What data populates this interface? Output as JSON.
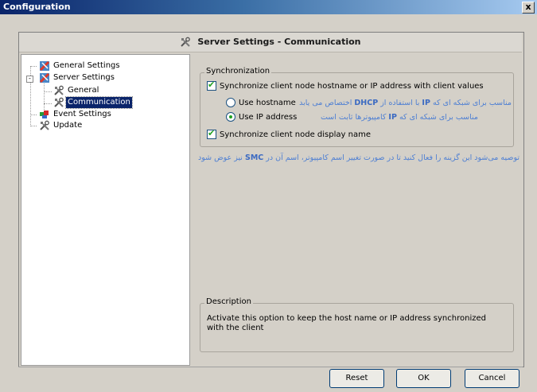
{
  "window": {
    "title": "Configuration",
    "close_label": "x"
  },
  "header": {
    "title": "Server Settings - Communication"
  },
  "tree": {
    "items": [
      {
        "label": "General Settings",
        "icon": "general-settings-icon"
      },
      {
        "label": "Server Settings",
        "icon": "server-settings-icon",
        "expander": "-"
      },
      {
        "label": "General",
        "icon": "tools-icon"
      },
      {
        "label": "Communication",
        "icon": "tools-icon",
        "selected": true
      },
      {
        "label": "Event Settings",
        "icon": "event-settings-icon"
      },
      {
        "label": "Update",
        "icon": "tools-icon"
      }
    ]
  },
  "sync": {
    "group_title": "Synchronization",
    "sync_hostname_label": "Synchronize client node hostname or IP address with client values",
    "sync_hostname_checked": true,
    "use_hostname_label": "Use hostname",
    "use_hostname_note_prefix": "مناسب برای شبکه ای که",
    "use_hostname_note_ip": "IP",
    "use_hostname_note_mid": "با استفاده از",
    "use_hostname_note_dhcp": "DHCP",
    "use_hostname_note_suffix": "اختصاص می یابد",
    "use_ip_label": "Use IP address",
    "use_ip_selected": true,
    "use_ip_note_prefix": "مناسب برای شبکه ای که",
    "use_ip_note_ip": "IP",
    "use_ip_note_suffix": "کامپیوترها ثابت است",
    "sync_display_label": "Synchronize client node display name",
    "sync_display_checked": true
  },
  "recommend_note": {
    "prefix": "توصیه می‌شود این گزینه را فعال کنید تا در صورت تغییر اسم کامپیوتر، اسم آن در",
    "smc": "SMC",
    "suffix": "نیز عوض شود"
  },
  "description": {
    "group_title": "Description",
    "text": "Activate this option to keep the host name or IP address synchronized with the client"
  },
  "buttons": {
    "reset": "Reset",
    "ok": "OK",
    "cancel": "Cancel"
  },
  "colors": {
    "title_bar": "#0a246a",
    "selection": "#0a246a",
    "note_text": "#4e7fd3",
    "check_mark": "#21a121"
  }
}
